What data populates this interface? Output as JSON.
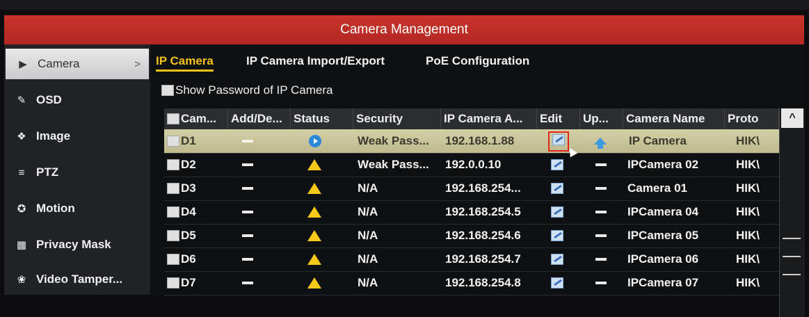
{
  "window": {
    "title": "Camera Management"
  },
  "sidebar": {
    "items": [
      {
        "label": "Camera",
        "icon": "camera-icon",
        "active": true
      },
      {
        "label": "OSD",
        "icon": "osd-icon"
      },
      {
        "label": "Image",
        "icon": "image-icon"
      },
      {
        "label": "PTZ",
        "icon": "ptz-icon"
      },
      {
        "label": "Motion",
        "icon": "motion-icon"
      },
      {
        "label": "Privacy Mask",
        "icon": "privacy-mask-icon"
      },
      {
        "label": "Video Tamper...",
        "icon": "video-tamper-icon"
      }
    ],
    "active_chevron": ">"
  },
  "tabs": [
    "IP Camera",
    "IP Camera Import/Export",
    "PoE Configuration"
  ],
  "show_password": {
    "label": "Show Password of IP Camera",
    "checked": false
  },
  "table": {
    "columns": [
      "Cam...",
      "Add/De...",
      "Status",
      "Security",
      "IP Camera A...",
      "Edit",
      "Up...",
      "Camera Name",
      "Proto"
    ],
    "rows": [
      {
        "cam": "D1",
        "status": "online",
        "security": "Weak Pass...",
        "ip": "192.168.1.88",
        "upgrade": "icon",
        "name": "IP Camera",
        "proto": "HIK\\",
        "selected": true
      },
      {
        "cam": "D2",
        "status": "warning",
        "security": "Weak Pass...",
        "ip": "192.0.0.10",
        "upgrade": "–",
        "name": "IPCamera 02",
        "proto": "HIK\\"
      },
      {
        "cam": "D3",
        "status": "warning",
        "security": "N/A",
        "ip": "192.168.254...",
        "upgrade": "–",
        "name": "Camera 01",
        "proto": "HIK\\"
      },
      {
        "cam": "D4",
        "status": "warning",
        "security": "N/A",
        "ip": "192.168.254.5",
        "upgrade": "–",
        "name": "IPCamera 04",
        "proto": "HIK\\"
      },
      {
        "cam": "D5",
        "status": "warning",
        "security": "N/A",
        "ip": "192.168.254.6",
        "upgrade": "–",
        "name": "IPCamera 05",
        "proto": "HIK\\"
      },
      {
        "cam": "D6",
        "status": "warning",
        "security": "N/A",
        "ip": "192.168.254.7",
        "upgrade": "–",
        "name": "IPCamera 06",
        "proto": "HIK\\"
      },
      {
        "cam": "D7",
        "status": "warning",
        "security": "N/A",
        "ip": "192.168.254.8",
        "upgrade": "–",
        "name": "IPCamera 07",
        "proto": "HIK\\"
      }
    ]
  },
  "scrollbar": {
    "up_arrow": "^"
  },
  "colors": {
    "title_bar": "#c1302a",
    "tab_active": "#f2c21b",
    "selected_row": "#cfc9a0",
    "warning": "#f5c81a",
    "edit_highlight": "#e0281e"
  }
}
